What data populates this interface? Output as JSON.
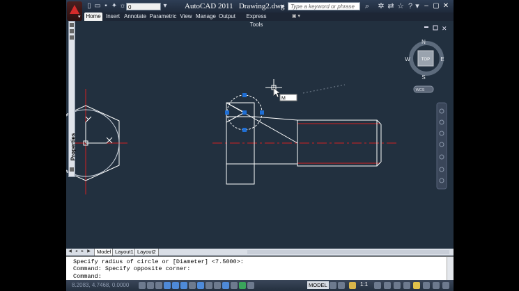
{
  "window": {
    "app_title": "AutoCAD 2011",
    "doc_title": "Drawing2.dwg"
  },
  "quick_access": {
    "layer_value": "0"
  },
  "search": {
    "placeholder": "Type a keyword or phrase"
  },
  "ribbon": {
    "tabs": [
      "Home",
      "Insert",
      "Annotate",
      "Parametric",
      "View",
      "Manage",
      "Output",
      "Express Tools"
    ],
    "active_tab": "Home"
  },
  "palette": {
    "label": "Properties"
  },
  "viewcube": {
    "north": "N",
    "south": "S",
    "east": "E",
    "west": "W",
    "face": "TOP",
    "wcs": "WCS"
  },
  "cursor": {
    "dynamic_input": "M"
  },
  "layout_tabs": [
    "Model",
    "Layout1",
    "Layout2"
  ],
  "active_layout": "Model",
  "command": {
    "line1": "Specify radius of circle or [Diameter] <7.5000>:",
    "line2": "Command: Specify opposite corner:",
    "line3": "Command:"
  },
  "status": {
    "coordinates": "8.2083, 4.7468, 0.0000",
    "model_label": "MODEL",
    "annotation_scale": "1:1"
  },
  "colors": {
    "canvas": "#22303f",
    "geometry": "#ffffff",
    "centerline": "#d42020",
    "grip": "#1f6fd6",
    "ribbon_active": "#f2f2f2"
  }
}
